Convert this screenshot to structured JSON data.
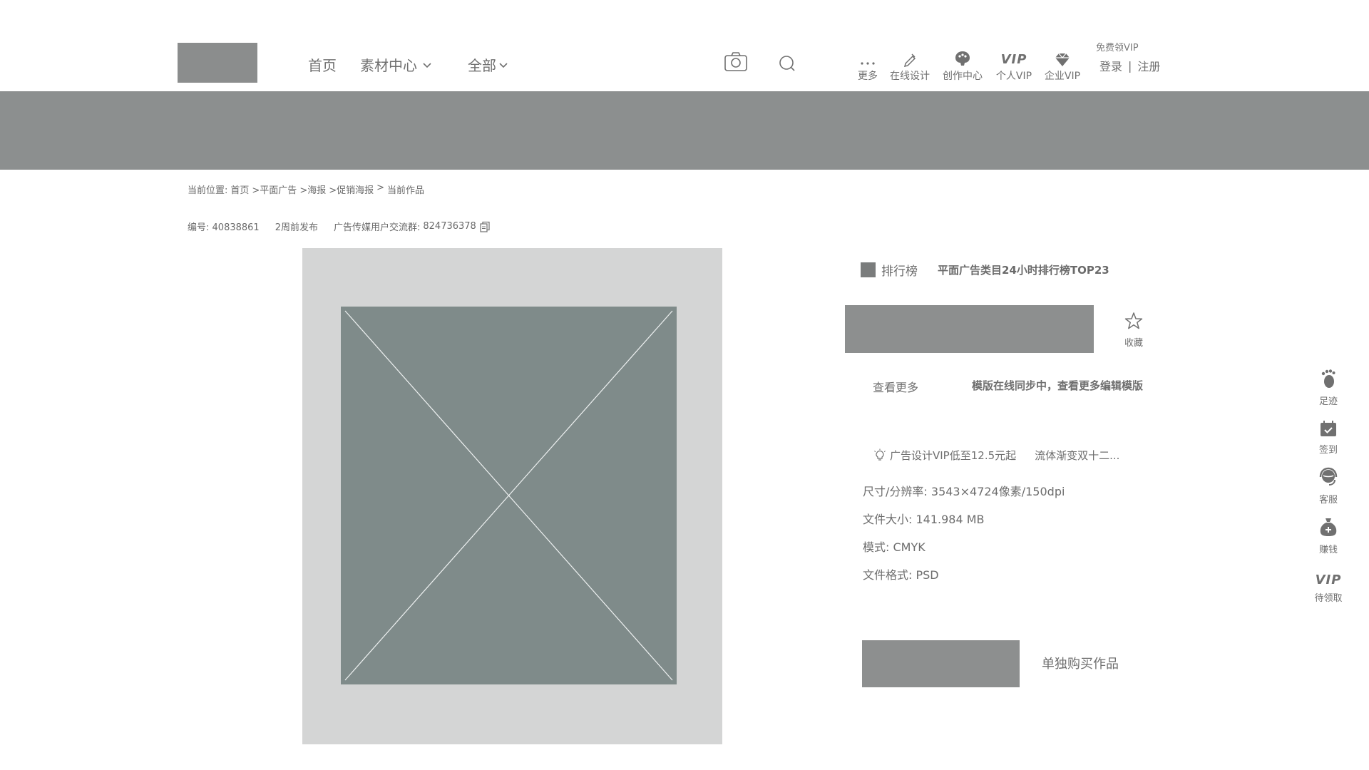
{
  "header": {
    "nav": [
      {
        "label": "首页",
        "has_dropdown": false
      },
      {
        "label": "素材中心",
        "has_dropdown": true
      },
      {
        "label": "全部",
        "has_dropdown": true
      }
    ],
    "tools": [
      {
        "label": "更多",
        "icon": "more-icon"
      },
      {
        "label": "在线设计",
        "icon": "pen-icon"
      },
      {
        "label": "创作中心",
        "icon": "palette-icon"
      },
      {
        "label": "个人VIP",
        "icon": "vip-icon",
        "glyph": "VIP"
      },
      {
        "label": "企业VIP",
        "icon": "diamond-icon"
      }
    ],
    "vip_promo": "免费领VIP",
    "login": "登录",
    "separator": "|",
    "register": "注册"
  },
  "breadcrumb": {
    "prefix": "当前位置:",
    "items": [
      "首页",
      ">平面广告",
      ">海报",
      ">促销海报",
      ">",
      "当前作品"
    ]
  },
  "info": {
    "id_label": "编号:",
    "id_value": "40838861",
    "published": "2周前发布",
    "group_label": "广告传媒用户交流群:",
    "group_value": "824736378"
  },
  "rank": {
    "title": "排行榜",
    "subtitle": "平面广告类目24小时排行榜TOP23"
  },
  "collect_label": "收藏",
  "see_more": "查看更多",
  "sync_note": "模版在线同步中，查看更多编辑模版",
  "promos": [
    "广告设计VIP低至12.5元起",
    "流体渐变双十二..."
  ],
  "specs": [
    {
      "label": "尺寸/分辨率:",
      "value": "3543×4724像素/150dpi"
    },
    {
      "label": "文件大小:",
      "value": "141.984 MB"
    },
    {
      "label": "模式:",
      "value": "CMYK"
    },
    {
      "label": "文件格式:",
      "value": "PSD"
    }
  ],
  "buy_single": "单独购买作品",
  "float_bar": [
    {
      "label": "足迹",
      "icon": "footprint-icon"
    },
    {
      "label": "签到",
      "icon": "calendar-check-icon"
    },
    {
      "label": "客服",
      "icon": "customer-service-icon"
    },
    {
      "label": "赚钱",
      "icon": "money-bag-icon"
    },
    {
      "label": "待领取",
      "icon": "vip-icon",
      "glyph": "VIP"
    }
  ],
  "colors": {
    "placeholder_dark": "#8c8f8f",
    "placeholder_light": "#d4d5d5",
    "image_fill": "#7f8b8a",
    "text": "#6f6f6f"
  }
}
